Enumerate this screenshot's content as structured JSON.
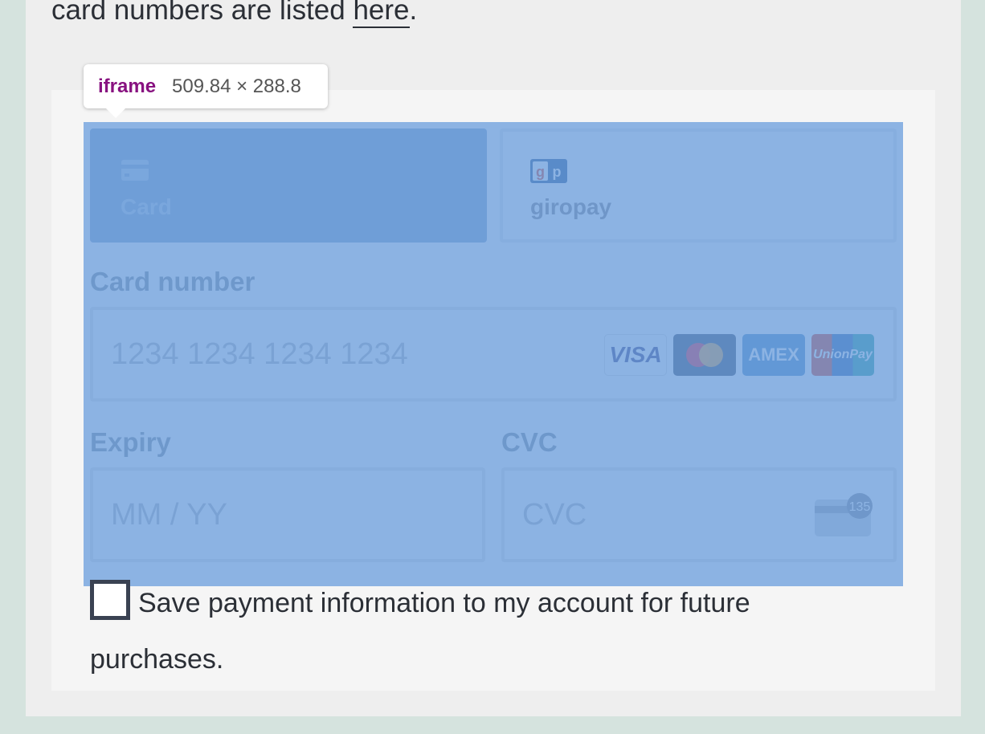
{
  "intro": {
    "text_before_link": "card numbers are listed ",
    "link_text": "here",
    "text_after_link": "."
  },
  "tooltip": {
    "tag": "iframe",
    "dimensions": "509.84 × 288.8"
  },
  "payment_tabs": [
    {
      "label": "Card",
      "icon": "card-icon",
      "selected": true
    },
    {
      "label": "giropay",
      "icon": "giropay-icon",
      "selected": false
    }
  ],
  "card_number": {
    "label": "Card number",
    "placeholder": "1234 1234 1234 1234",
    "brands": [
      "VISA",
      "mastercard",
      "AMEX",
      "UnionPay"
    ]
  },
  "expiry": {
    "label": "Expiry",
    "placeholder": "MM / YY"
  },
  "cvc": {
    "label": "CVC",
    "placeholder": "CVC",
    "hint_number": "135"
  },
  "save_payment": {
    "label_line1": "Save payment information to my account for future",
    "label_line2": "purchases.",
    "checked": false
  },
  "colors": {
    "overlay": "#6fa0dc",
    "tooltip_tag": "#881280",
    "page_bg": "#d5e3de"
  }
}
